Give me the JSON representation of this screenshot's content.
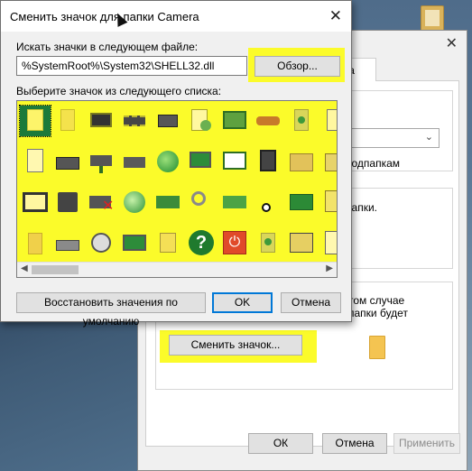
{
  "dialog": {
    "title": "Сменить значок для папки Camera",
    "file_label": "Искать значки в следующем файле:",
    "file_value": "%SystemRoot%\\System32\\SHELL32.dll",
    "browse_label": "Обзор...",
    "list_label": "Выберите значок из следующего списка:",
    "restore_label": "Восстановить значения по умолчанию",
    "ok_label": "OK",
    "cancel_label": "Отмена",
    "close_glyph": "✕"
  },
  "properties": {
    "tab_label": "йка",
    "subfolders_text": "подпапкам",
    "folder_text": "й папки.",
    "info_line1": "том случае",
    "info_line2": "папки будет",
    "change_icon_label": "Сменить значок...",
    "ok_label": "ОК",
    "cancel_label": "Отмена",
    "apply_label": "Применить",
    "close_glyph": "✕"
  },
  "colors": {
    "highlight": "#fbfb2a",
    "accent": "#0078d7",
    "selected_icon": "#1c7a3a"
  }
}
